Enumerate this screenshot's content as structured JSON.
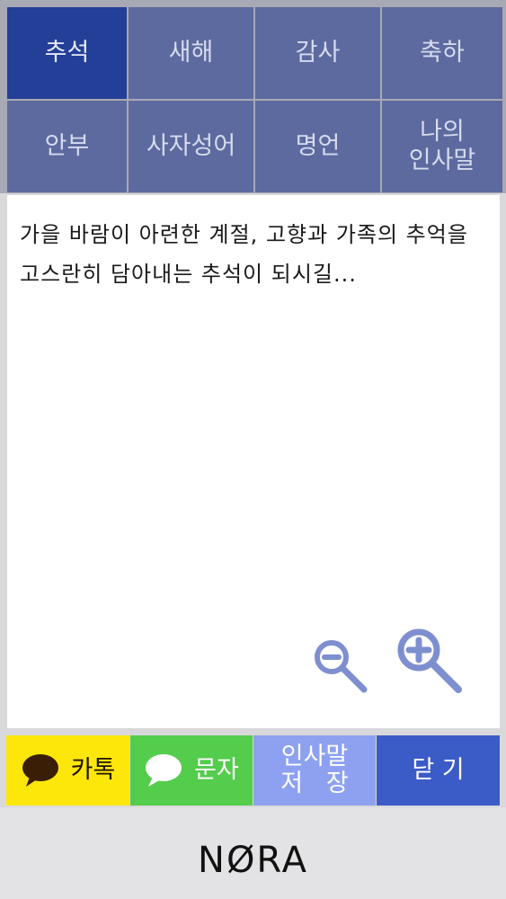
{
  "tabs": [
    {
      "label": "추석",
      "active": true
    },
    {
      "label": "새해",
      "active": false
    },
    {
      "label": "감사",
      "active": false
    },
    {
      "label": "축하",
      "active": false
    },
    {
      "label": "안부",
      "active": false
    },
    {
      "label": "사자성어",
      "active": false
    },
    {
      "label": "명언",
      "active": false
    },
    {
      "label": "나의\n인사말",
      "active": false
    }
  ],
  "message": "가을 바람이 아련한 계절, 고향과 가족의 추억을 고스란히 담아내는 추석이 되시길...",
  "actions": {
    "kakao_label": "카톡",
    "sms_label": "문자",
    "save_label_line1": "인사말",
    "save_label_line2": "저   장",
    "close_label": "닫 기"
  },
  "footer": {
    "brand": "NØRA"
  },
  "colors": {
    "tab": "#5d6a9f",
    "tab_active": "#233f97",
    "kakao": "#fde70b",
    "sms": "#54cc4c",
    "save": "#8da1f0",
    "close": "#3b5bc7",
    "zoom_icon": "#7e8fd0"
  }
}
